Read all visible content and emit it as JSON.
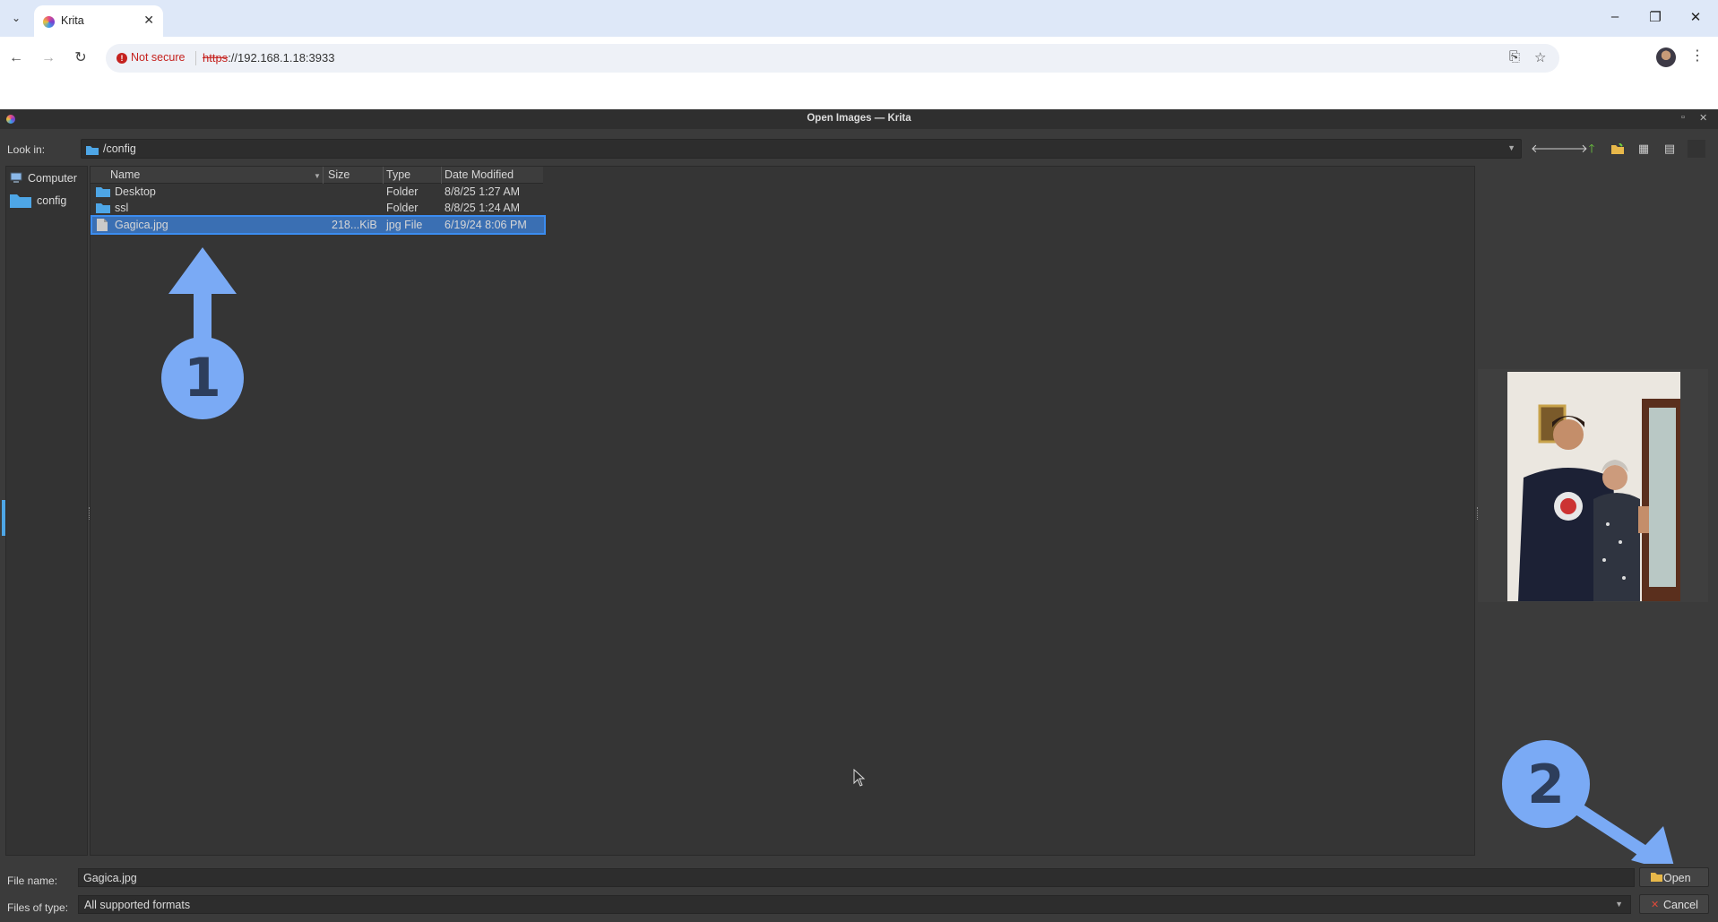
{
  "browser": {
    "tab_title": "Krita",
    "security_label": "Not secure",
    "url_scheme": "https",
    "url_rest": "://192.168.1.18:3933"
  },
  "dialog": {
    "title": "Open Images — Krita",
    "look_in_label": "Look in:",
    "look_in_value": "/config",
    "sidebar": [
      {
        "label": "Computer",
        "icon": "computer-icon"
      },
      {
        "label": "config",
        "icon": "folder-icon"
      }
    ],
    "columns": [
      "Name",
      "Size",
      "Type",
      "Date Modified"
    ],
    "files": [
      {
        "name": "Desktop",
        "size": "",
        "type": "Folder",
        "modified": "8/8/25 1:27 AM",
        "icon": "folder-icon"
      },
      {
        "name": "ssl",
        "size": "",
        "type": "Folder",
        "modified": "8/8/25 1:24 AM",
        "icon": "folder-icon"
      },
      {
        "name": "Gagica.jpg",
        "size": "218...KiB",
        "type": "jpg File",
        "modified": "6/19/24 8:06 PM",
        "icon": "file-icon",
        "selected": true
      }
    ],
    "file_name_label": "File name:",
    "file_name_value": "Gagica.jpg",
    "file_type_label": "Files of type:",
    "file_type_value": "All supported formats",
    "open_label": "Open",
    "cancel_label": "Cancel"
  },
  "annotations": {
    "step1": "1",
    "step2": "2",
    "color": "#7aaaf5"
  }
}
